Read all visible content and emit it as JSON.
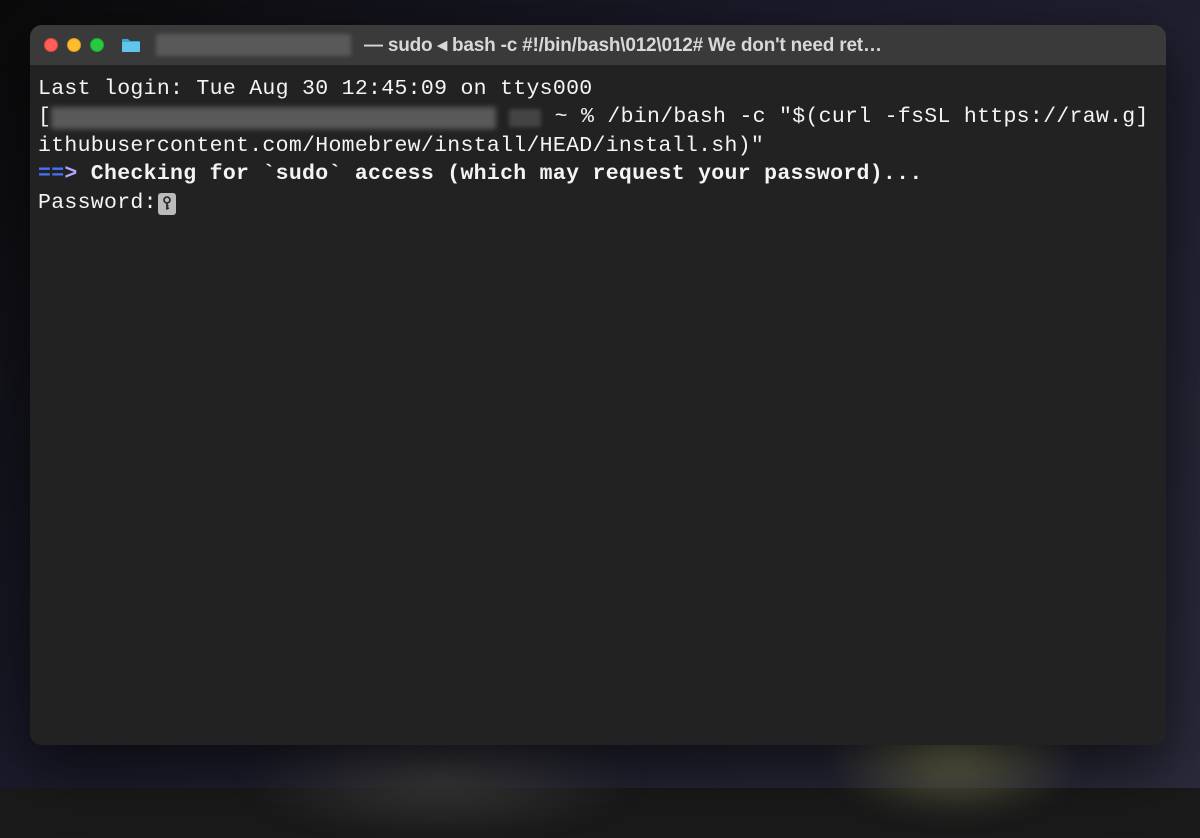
{
  "window": {
    "title": "— sudo ◂ bash -c #!/bin/bash\\012\\012# We don't need ret…"
  },
  "terminal": {
    "last_login": "Last login: Tue Aug 30 12:45:09 on ttys000",
    "prompt_suffix": " ~ % ",
    "command_part1": "/bin/bash -c \"$(curl -fsSL https://raw.g",
    "command_part2": "ithubusercontent.com/Homebrew/install/HEAD/install.sh)\"",
    "arrow_prefix": "==",
    "arrow_suffix": ">",
    "check_line": " Checking for `sudo` access (which may request your password)...",
    "password_prompt": "Password:",
    "bracket_open": "[",
    "bracket_close": "]"
  }
}
